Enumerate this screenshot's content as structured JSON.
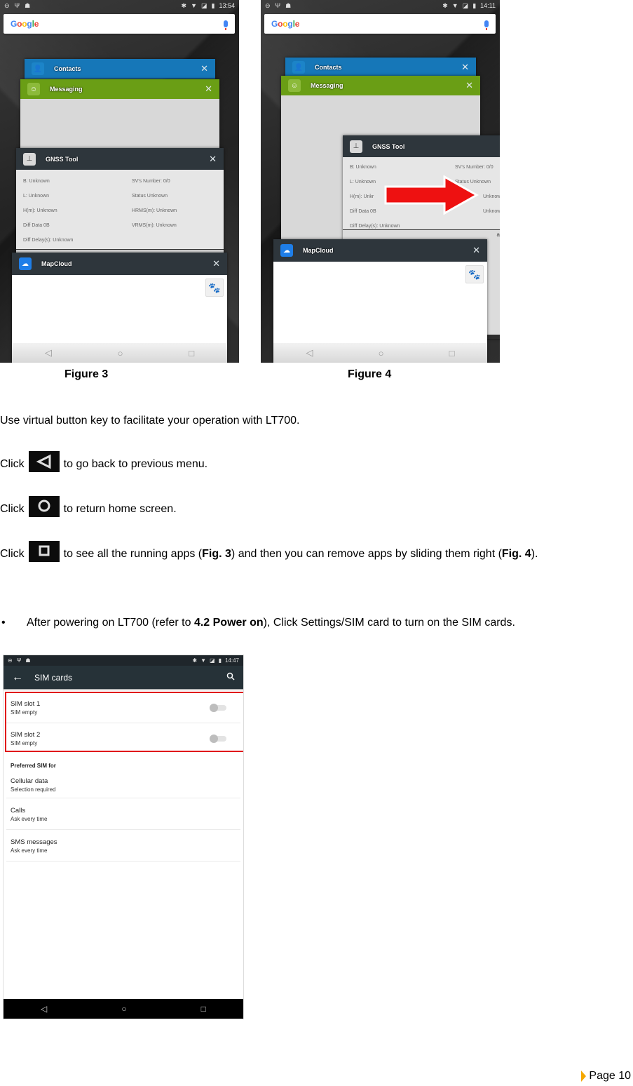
{
  "figure3": {
    "label": "Figure 3",
    "status_time": "13:54",
    "search_logo": [
      "G",
      "o",
      "o",
      "g",
      "l",
      "e"
    ],
    "cards": {
      "contacts": {
        "title": "Contacts"
      },
      "messaging": {
        "title": "Messaging"
      },
      "gnss": {
        "title": "GNSS Tool",
        "rows": [
          [
            "B:   Unknown",
            "SV's Number:  0/0"
          ],
          [
            "L:   Unknown",
            "Status   Unknown"
          ],
          [
            "H(m):   Unknown",
            "HRMS(m):  Unknown"
          ],
          [
            "Diff Data   0B",
            "VRMS(m):  Unknown"
          ],
          [
            "Diff Delay(s):  Unknown",
            ""
          ]
        ]
      },
      "mapcloud": {
        "title": "MapCloud"
      }
    },
    "close_glyph": "✕",
    "nav": {
      "back": "◁",
      "home": "○",
      "recents": "□"
    }
  },
  "figure4": {
    "label": "Figure 4",
    "status_time": "14:11",
    "cards": {
      "contacts": {
        "title": "Contacts"
      },
      "messaging": {
        "title": "Messaging"
      },
      "gnss": {
        "title": "GNSS Tool",
        "rows": [
          [
            "B:   Unknown",
            "SV's Number:  0/0"
          ],
          [
            "L:   Unknown",
            "Status   Unknown"
          ],
          [
            "H(m):   Unkr",
            "Unknown"
          ],
          [
            "Diff Data   0B",
            "Unknown"
          ],
          [
            "Diff Delay(s):  Unknown",
            ""
          ]
        ]
      },
      "mapcloud": {
        "title": "MapCloud"
      },
      "peek_text": "alUn"
    },
    "arrow_color": "#ee1111"
  },
  "text": {
    "intro": "Use virtual button key to facilitate your operation with LT700.",
    "click": "Click",
    "back_desc": "to go back to previous menu.",
    "home_desc": "to return home screen.",
    "recents_desc_a": "to see all the running apps (",
    "fig3_ref": "Fig. 3",
    "recents_desc_b": ") and then you can remove apps by sliding them right (",
    "fig4_ref": "Fig. 4",
    "recents_desc_c": ").",
    "bullet": "•",
    "bullet_a": "After powering on LT700 (refer to ",
    "bullet_ref": "4.2 Power on",
    "bullet_b": "), Click Settings/SIM card to turn on the SIM cards."
  },
  "sim_screen": {
    "status_time": "14:47",
    "title": "SIM cards",
    "back_glyph": "←",
    "search_glyph": "🔍",
    "slots": [
      {
        "title": "SIM slot 1",
        "subtitle": "SIM empty",
        "enabled": false
      },
      {
        "title": "SIM slot 2",
        "subtitle": "SIM empty",
        "enabled": false
      }
    ],
    "pref_heading": "Preferred SIM for",
    "prefs": [
      {
        "title": "Cellular data",
        "subtitle": "Selection required"
      },
      {
        "title": "Calls",
        "subtitle": "Ask every time"
      },
      {
        "title": "SMS messages",
        "subtitle": "Ask every time"
      }
    ],
    "highlight_color": "#e0141a"
  },
  "footer": {
    "page": "Page 10",
    "accent": "#f5a800"
  }
}
